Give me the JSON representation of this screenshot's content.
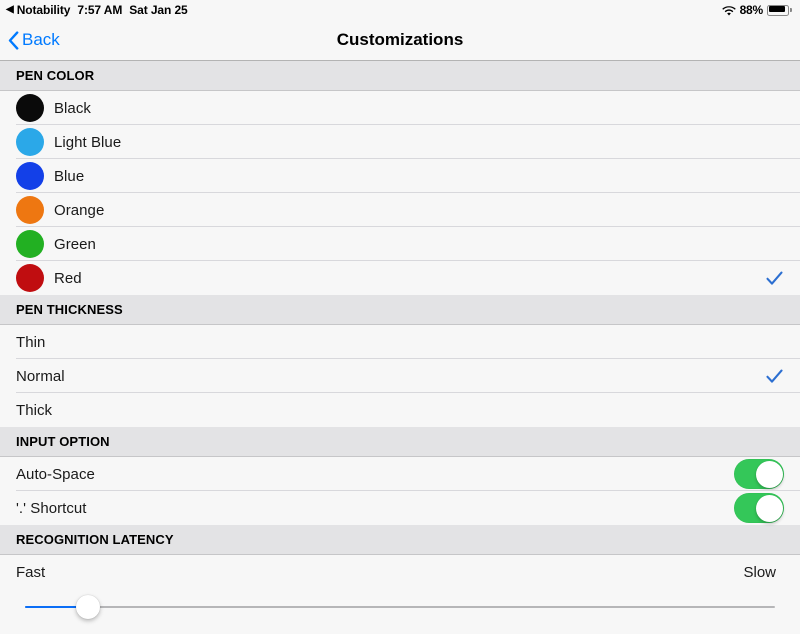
{
  "status_bar": {
    "back_glyph": "◀",
    "app_name": "Notability",
    "time": "7:57 AM",
    "date": "Sat Jan 25",
    "wifi_icon": "wifi-icon",
    "battery_percent": "88%",
    "battery_level": 88
  },
  "nav": {
    "back_label": "Back",
    "back_icon": "chevron-left-icon",
    "title": "Customizations",
    "tint_color": "#007aff"
  },
  "sections": [
    {
      "header": "PEN COLOR",
      "rows": [
        {
          "label": "Black",
          "color": "#0a0a0a",
          "checked": false
        },
        {
          "label": "Light Blue",
          "color": "#2ba8e8",
          "checked": false
        },
        {
          "label": "Blue",
          "color": "#1340e8",
          "checked": false
        },
        {
          "label": "Orange",
          "color": "#ee7711",
          "checked": false
        },
        {
          "label": "Green",
          "color": "#22b022",
          "checked": false
        },
        {
          "label": "Red",
          "color": "#c00d10",
          "checked": true
        }
      ]
    },
    {
      "header": "PEN THICKNESS",
      "rows": [
        {
          "label": "Thin",
          "checked": false
        },
        {
          "label": "Normal",
          "checked": true
        },
        {
          "label": "Thick",
          "checked": false
        }
      ]
    },
    {
      "header": "INPUT OPTION",
      "rows": [
        {
          "label": "Auto-Space",
          "toggle": true
        },
        {
          "label": "'.' Shortcut",
          "toggle": true
        }
      ]
    },
    {
      "header": "RECOGNITION LATENCY",
      "slider": {
        "min_label": "Fast",
        "max_label": "Slow",
        "value_percent": 8.4
      }
    }
  ],
  "colors": {
    "checkmark": "#2c6fd1",
    "toggle_on": "#34c759",
    "slider_fill": "#0b6ef6",
    "section_header_bg": "#e3e3e5",
    "row_bg": "#f7f7f7"
  }
}
